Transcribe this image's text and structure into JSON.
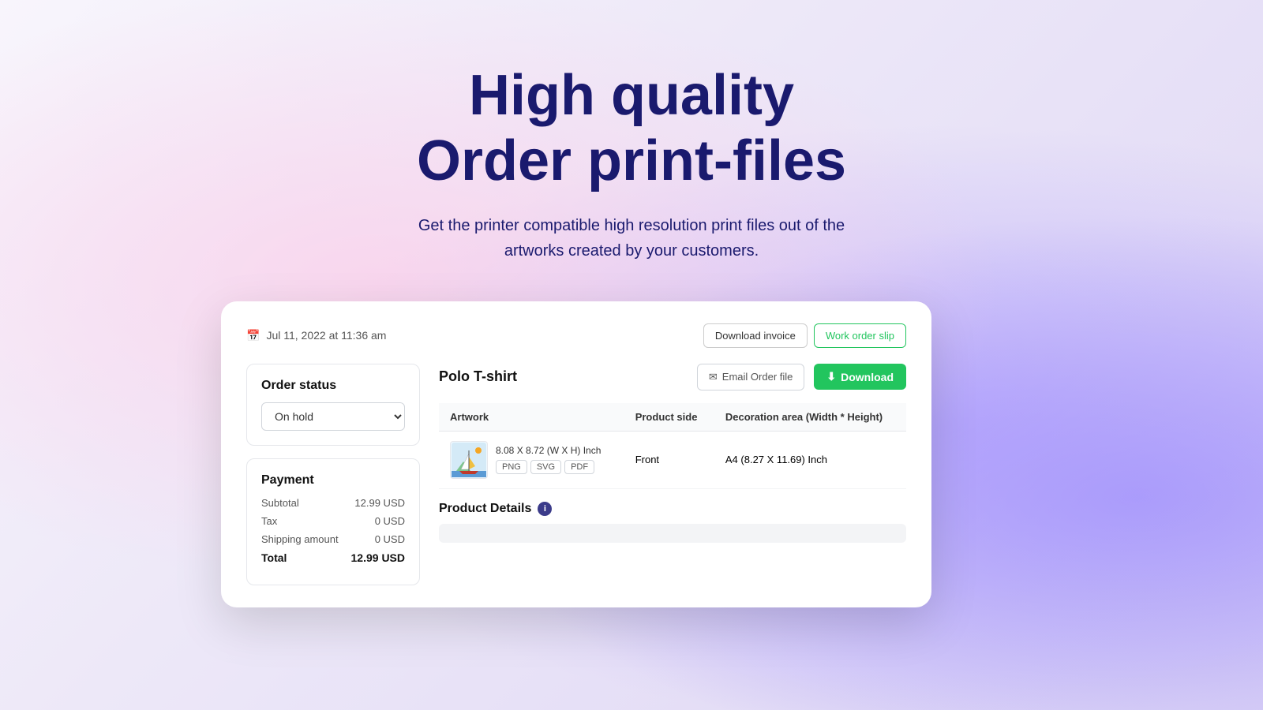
{
  "hero": {
    "title_line1": "High quality",
    "title_line2": "Order print-files",
    "subtitle_line1": "Get the printer compatible high resolution print files out of the",
    "subtitle_line2": "artworks created by your customers."
  },
  "card": {
    "date": "Jul 11, 2022 at 11:36 am",
    "buttons": {
      "download_invoice": "Download invoice",
      "work_order_slip": "Work order slip"
    },
    "order_status": {
      "title": "Order status",
      "value": "On hold"
    },
    "payment": {
      "title": "Payment",
      "subtotal_label": "Subtotal",
      "subtotal_value": "12.99 USD",
      "tax_label": "Tax",
      "tax_value": "0 USD",
      "shipping_label": "Shipping amount",
      "shipping_value": "0 USD",
      "total_label": "Total",
      "total_value": "12.99 USD"
    },
    "product": {
      "name": "Polo T-shirt",
      "email_btn": "Email Order file",
      "download_btn": "Download",
      "table": {
        "headers": [
          "Artwork",
          "Product side",
          "Decoration area (Width * Height)"
        ],
        "rows": [
          {
            "dims": "8.08 X 8.72 (W X H) Inch",
            "formats": [
              "PNG",
              "SVG",
              "PDF"
            ],
            "side": "Front",
            "area": "A4 (8.27 X 11.69) Inch"
          }
        ]
      },
      "details_title": "Product Details"
    }
  }
}
